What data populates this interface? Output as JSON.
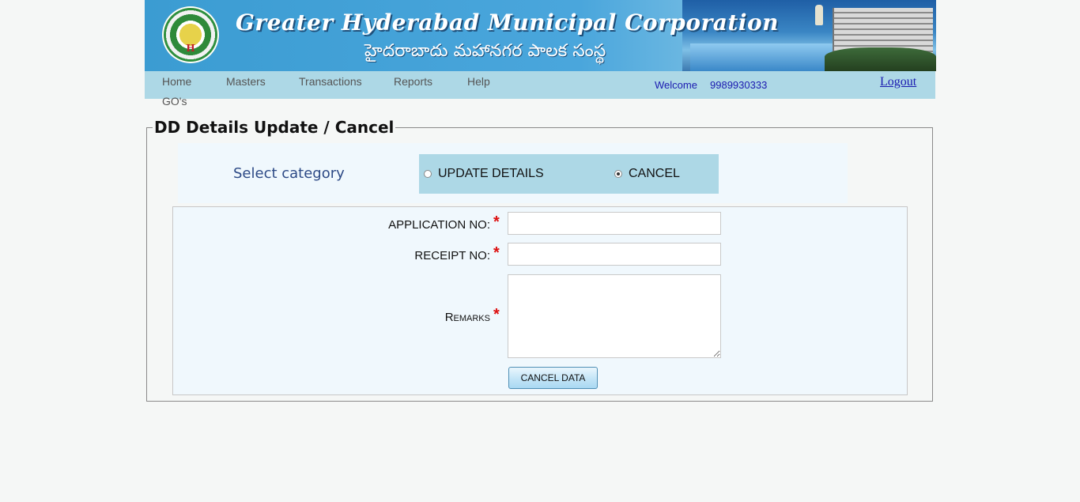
{
  "header": {
    "title_en": "Greater Hyderabad Municipal Corporation",
    "title_te": "హైదరాబాదు మహానగర పాలక సంస్థ"
  },
  "nav": {
    "items": [
      "Home",
      "Masters",
      "Transactions",
      "Reports",
      "Help",
      "GO's"
    ],
    "welcome_label": "Welcome",
    "user_id": "9989930333",
    "logout_label": "Logout"
  },
  "page": {
    "title": "DD Details Update / Cancel"
  },
  "category": {
    "label": "Select category",
    "options": [
      {
        "label": "UPDATE DETAILS",
        "checked": false
      },
      {
        "label": "CANCEL",
        "checked": true
      }
    ]
  },
  "form": {
    "application_no_label": "APPLICATION NO:",
    "receipt_no_label": "RECEIPT NO:",
    "remarks_label_first": "R",
    "remarks_label_rest": "EMARKS",
    "required_mark": "*",
    "application_no_value": "",
    "receipt_no_value": "",
    "remarks_value": "",
    "submit_label": "CANCEL DATA"
  },
  "colors": {
    "nav_bg": "#add8e6",
    "panel_bg": "#f0f8fd",
    "link_blue": "#1a1ab0",
    "required_red": "#dd1111"
  }
}
